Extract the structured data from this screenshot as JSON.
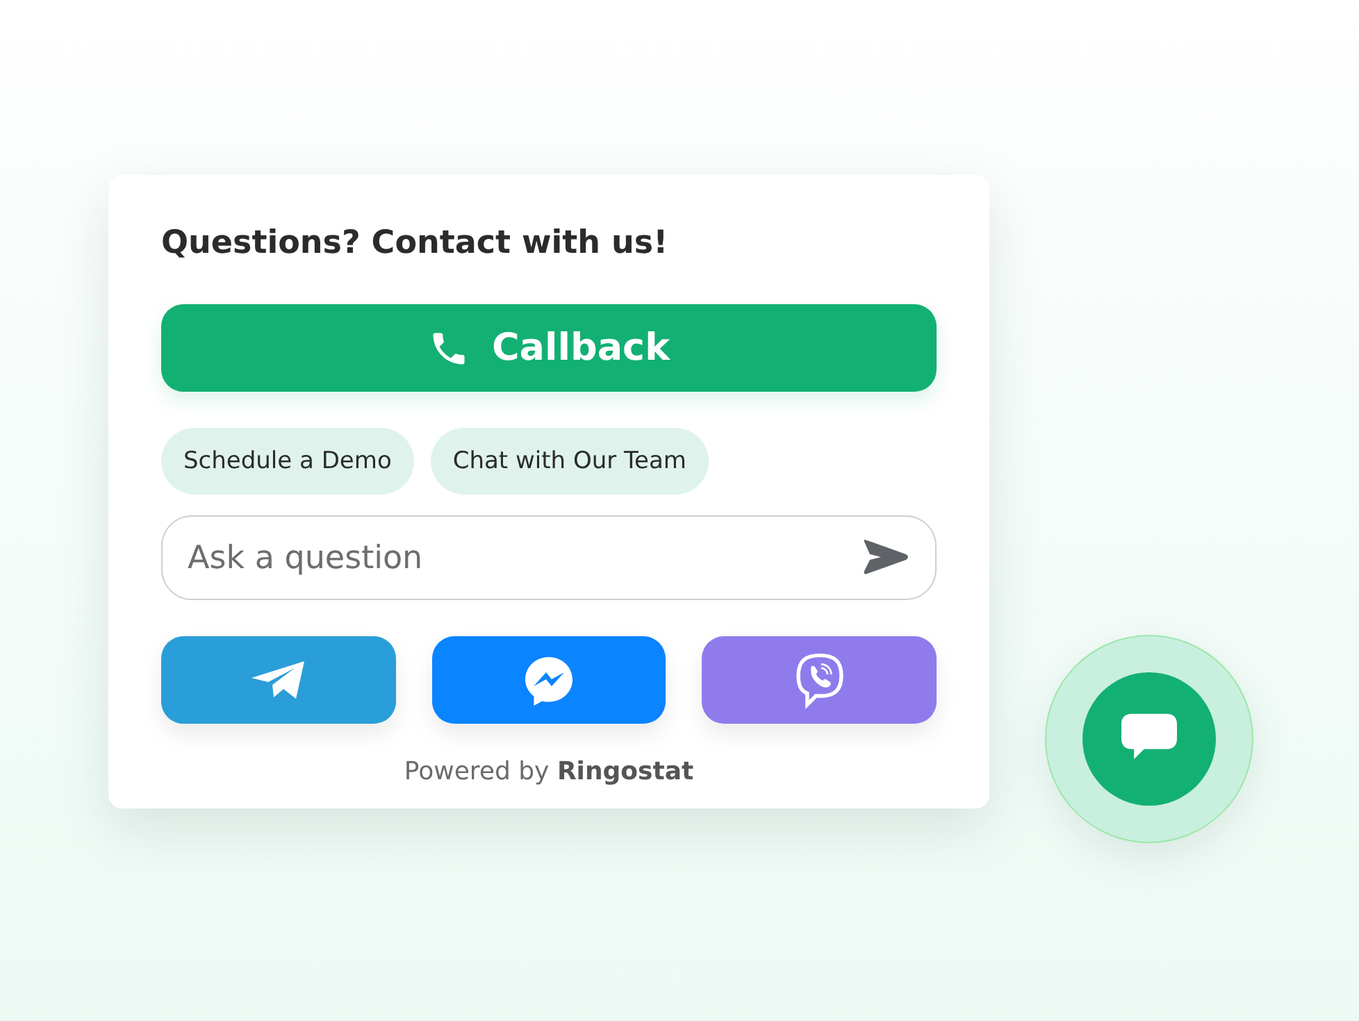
{
  "widget": {
    "title": "Questions? Contact with us!",
    "callback_button": {
      "label": "Callback"
    },
    "quick_replies": [
      {
        "label": "Schedule a Demo"
      },
      {
        "label": "Chat with Our Team"
      }
    ],
    "question_field": {
      "placeholder": "Ask a question"
    },
    "messengers": [
      {
        "kind": "telegram",
        "color": "#2a9ed8"
      },
      {
        "kind": "messenger",
        "color": "#0a84ff"
      },
      {
        "kind": "viber",
        "color": "#8f7bec"
      }
    ],
    "footer": "Powered by **Ringostat**"
  }
}
